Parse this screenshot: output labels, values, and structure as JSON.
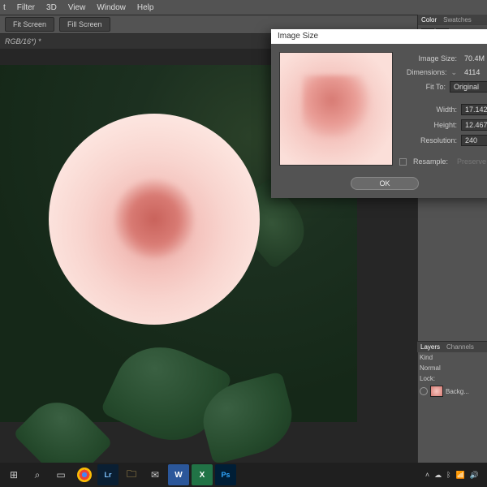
{
  "menu": {
    "items": [
      "t",
      "Filter",
      "3D",
      "View",
      "Window",
      "Help"
    ]
  },
  "toolstrip": {
    "fit": "Fit Screen",
    "fill": "Fill Screen"
  },
  "tab": {
    "label": "RGB/16*) *"
  },
  "panels": {
    "color_tab": "Color",
    "swatches_tab": "Swatches",
    "layers_tab": "Layers",
    "channels_tab": "Channels",
    "kind_label": "Kind",
    "blend_mode": "Normal",
    "lock_label": "Lock:",
    "layer_name": "Backg..."
  },
  "dialog": {
    "title": "Image Size",
    "image_size_label": "Image Size:",
    "image_size_value": "70.4M",
    "dimensions_label": "Dimensions:",
    "dimensions_value": "4114",
    "fit_to_label": "Fit To:",
    "fit_to_value": "Original",
    "width_label": "Width:",
    "width_value": "17.142",
    "height_label": "Height:",
    "height_value": "12.467",
    "resolution_label": "Resolution:",
    "resolution_value": "240",
    "resample_label": "Resample:",
    "resample_hint": "Preserve",
    "ok": "OK"
  },
  "taskbar": {
    "lr": "Lr",
    "ps": "Ps",
    "word": "W",
    "excel": "X"
  }
}
